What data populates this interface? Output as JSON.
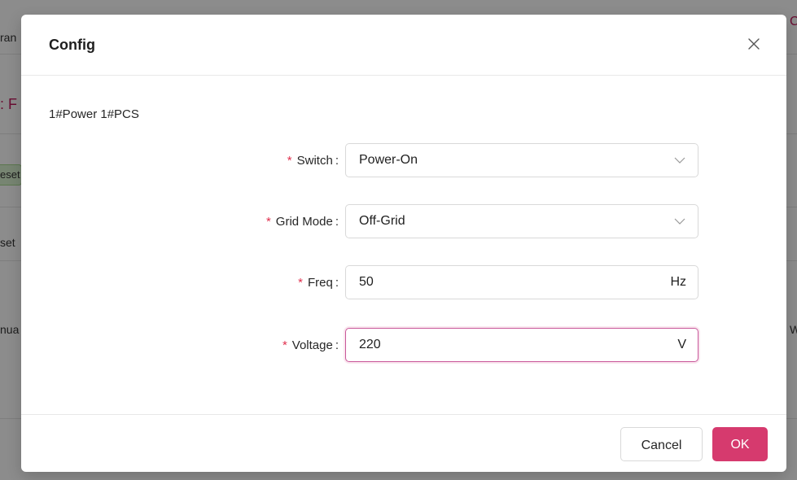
{
  "background": {
    "fragments": [
      "ran",
      ": F",
      "eset",
      "set",
      "nua",
      "W",
      "C"
    ]
  },
  "modal": {
    "title": "Config",
    "close_icon": "close-icon",
    "subtitle": "1#Power 1#PCS",
    "form": {
      "switch": {
        "label": "Switch",
        "value": "Power-On",
        "required": true
      },
      "grid_mode": {
        "label": "Grid Mode",
        "value": "Off-Grid",
        "required": true
      },
      "freq": {
        "label": "Freq",
        "value": "50",
        "unit": "Hz",
        "required": true
      },
      "voltage": {
        "label": "Voltage",
        "value": "220",
        "unit": "V",
        "required": true
      }
    },
    "footer": {
      "cancel_label": "Cancel",
      "ok_label": "OK"
    }
  },
  "colors": {
    "accent": "#d63a6e",
    "required": "#e0304e"
  }
}
